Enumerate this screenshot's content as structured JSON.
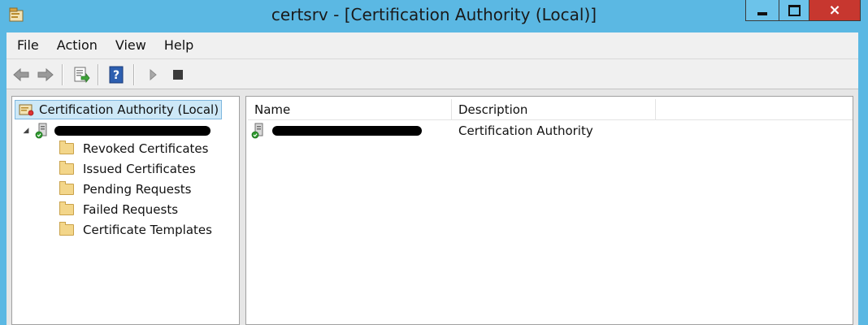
{
  "window": {
    "title": "certsrv - [Certification Authority (Local)]",
    "close_glyph": "×"
  },
  "menu": [
    "File",
    "Action",
    "View",
    "Help"
  ],
  "toolbar": {
    "icons": [
      "back-arrow-icon",
      "forward-arrow-icon",
      "export-list-icon",
      "help-icon",
      "start-service-icon",
      "stop-service-icon"
    ],
    "help_glyph": "?"
  },
  "tree": {
    "root": "Certification Authority (Local)",
    "ca_node_expander": "◢",
    "children": [
      "Revoked Certificates",
      "Issued Certificates",
      "Pending Requests",
      "Failed Requests",
      "Certificate Templates"
    ]
  },
  "list": {
    "columns": [
      "Name",
      "Description"
    ],
    "rows": [
      {
        "description": "Certification Authority"
      }
    ]
  },
  "colors": {
    "titlebar": "#5bb8e3",
    "close_button": "#c7372f",
    "selection": "#cde8f7"
  }
}
